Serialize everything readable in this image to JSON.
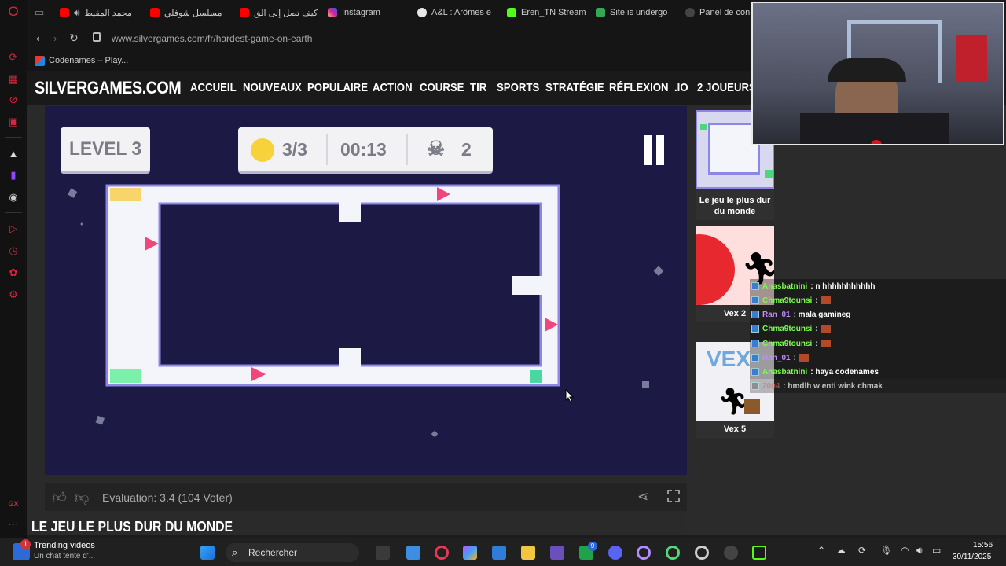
{
  "tabs": [
    {
      "label": "محمد المقيط",
      "fav": "#ff0000"
    },
    {
      "label": "مسلسل شوفلي",
      "fav": "#ff0000"
    },
    {
      "label": "كيف تصل إلى الق",
      "fav": "#ff0000"
    },
    {
      "label": "Instagram",
      "fav": "#d6249f"
    },
    {
      "label": "A&L : Arômes e",
      "fav": "#e8e8e8"
    },
    {
      "label": "Eren_TN Stream",
      "fav": "#53fc18"
    },
    {
      "label": "Site is undergo",
      "fav": "#34a853"
    },
    {
      "label": "Panel de con",
      "fav": "#444444"
    }
  ],
  "address": {
    "url": "www.silvergames.com/fr/hardest-game-on-earth"
  },
  "bookmark": {
    "label": "Codenames – Play..."
  },
  "site": {
    "logo": "SILVERGAMES.COM",
    "nav": [
      "ACCUEIL",
      "NOUVEAUX",
      "POPULAIRE",
      "ACTION",
      "COURSE",
      "TIR",
      "SPORTS",
      "STRATÉGIE",
      "RÉFLEXION",
      ".IO",
      "2 JOUEURS"
    ]
  },
  "game": {
    "level": "LEVEL 3",
    "coins": "3/3",
    "time": "00:13",
    "deaths": "2"
  },
  "rating": {
    "text": "Evaluation: 3.4 (104 Voter)"
  },
  "page_title": "LE JEU LE PLUS DUR DU MONDE",
  "related": [
    {
      "title": "Le jeu le plus dur du monde"
    },
    {
      "title": "Vex 2"
    },
    {
      "title": "Vex 5"
    }
  ],
  "chat": [
    {
      "user": "Anasbatnini",
      "msg": ": n hhhhhhhhhhh",
      "color": "#7cfc4f"
    },
    {
      "user": "Chma9tounsi",
      "msg": ":",
      "color": "#7cfc4f"
    },
    {
      "user": "Ran_01",
      "msg": ": mala gamineg",
      "color": "#c08bff"
    },
    {
      "user": "Chma9tounsi",
      "msg": ":",
      "color": "#7cfc4f"
    },
    {
      "user": "Chma9tounsi",
      "msg": ":",
      "color": "#7cfc4f"
    },
    {
      "user": "Ran_01",
      "msg": ":",
      "color": "#c08bff"
    },
    {
      "user": "Anasbatnini",
      "msg": ": haya codenames",
      "color": "#7cfc4f"
    },
    {
      "user": "2004",
      "msg": ": hmdlh w enti wink chmak",
      "color": "#b06060"
    }
  ],
  "taskbar": {
    "widget_title": "Trending videos",
    "widget_sub": "Un chat tente d'...",
    "widget_badge": "1",
    "search": "Rechercher",
    "time": "15:56",
    "date": "30/11/2025",
    "ms_store_badge": "9"
  }
}
